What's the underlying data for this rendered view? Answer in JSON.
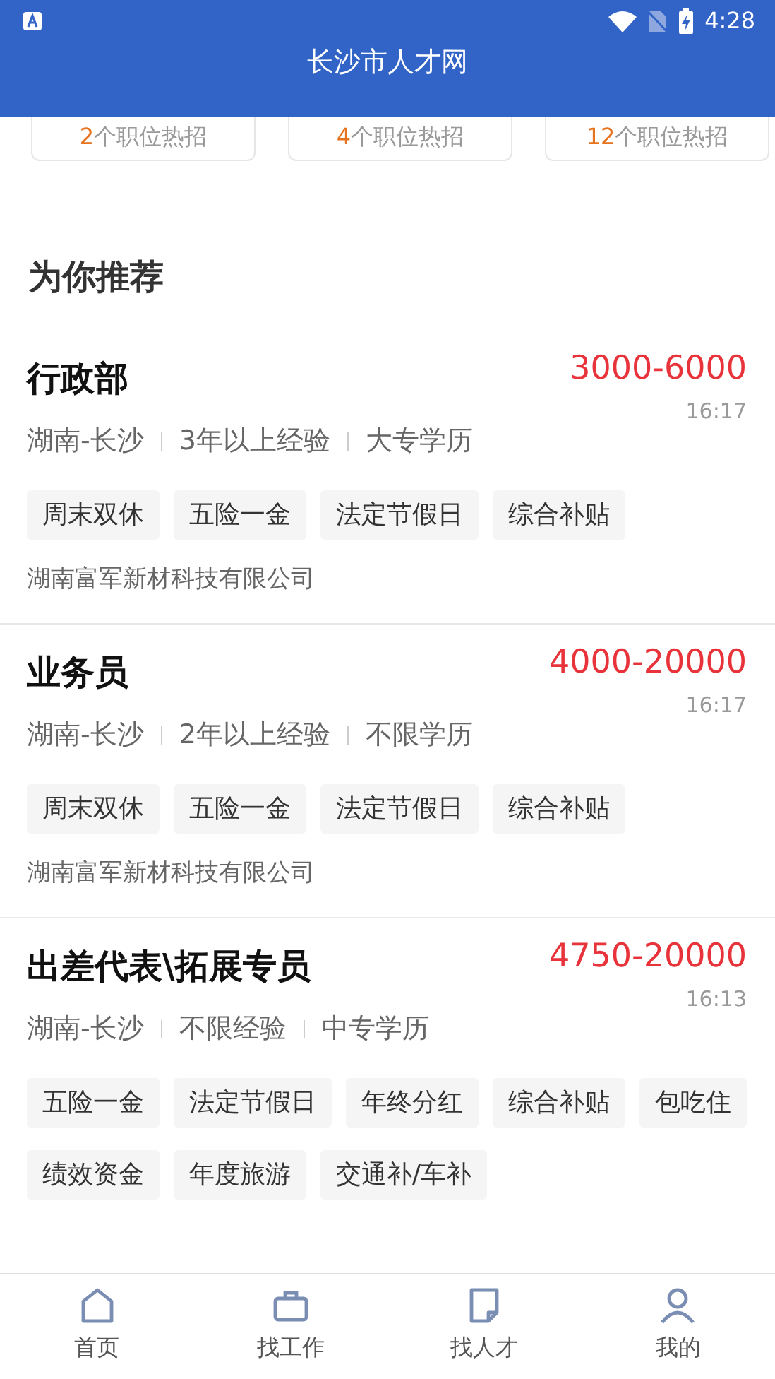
{
  "status_bar": {
    "time": "4:28"
  },
  "title": "长沙市人才网",
  "hot_cards": [
    {
      "count": "2",
      "label": "个职位热招"
    },
    {
      "count": "4",
      "label": "个职位热招"
    },
    {
      "count": "12",
      "label": "个职位热招"
    }
  ],
  "section_title": "为你推荐",
  "jobs": [
    {
      "title": "行政部",
      "salary": "3000-6000",
      "meta": [
        "湖南-长沙",
        "3年以上经验",
        "大专学历"
      ],
      "time": "16:17",
      "tags": [
        "周末双休",
        "五险一金",
        "法定节假日",
        "综合补贴"
      ],
      "company": "湖南富军新材科技有限公司"
    },
    {
      "title": "业务员",
      "salary": "4000-20000",
      "meta": [
        "湖南-长沙",
        "2年以上经验",
        "不限学历"
      ],
      "time": "16:17",
      "tags": [
        "周末双休",
        "五险一金",
        "法定节假日",
        "综合补贴"
      ],
      "company": "湖南富军新材科技有限公司"
    },
    {
      "title": "出差代表\\拓展专员",
      "salary": "4750-20000",
      "meta": [
        "湖南-长沙",
        "不限经验",
        "中专学历"
      ],
      "time": "16:13",
      "tags": [
        "五险一金",
        "法定节假日",
        "年终分红",
        "综合补贴",
        "包吃住",
        "绩效资金",
        "年度旅游",
        "交通补/车补"
      ]
    }
  ],
  "bottom_nav": [
    {
      "kind": "home",
      "label": "首页"
    },
    {
      "kind": "briefcase",
      "label": "找工作"
    },
    {
      "kind": "document",
      "label": "找人才"
    },
    {
      "kind": "person",
      "label": "我的"
    }
  ]
}
